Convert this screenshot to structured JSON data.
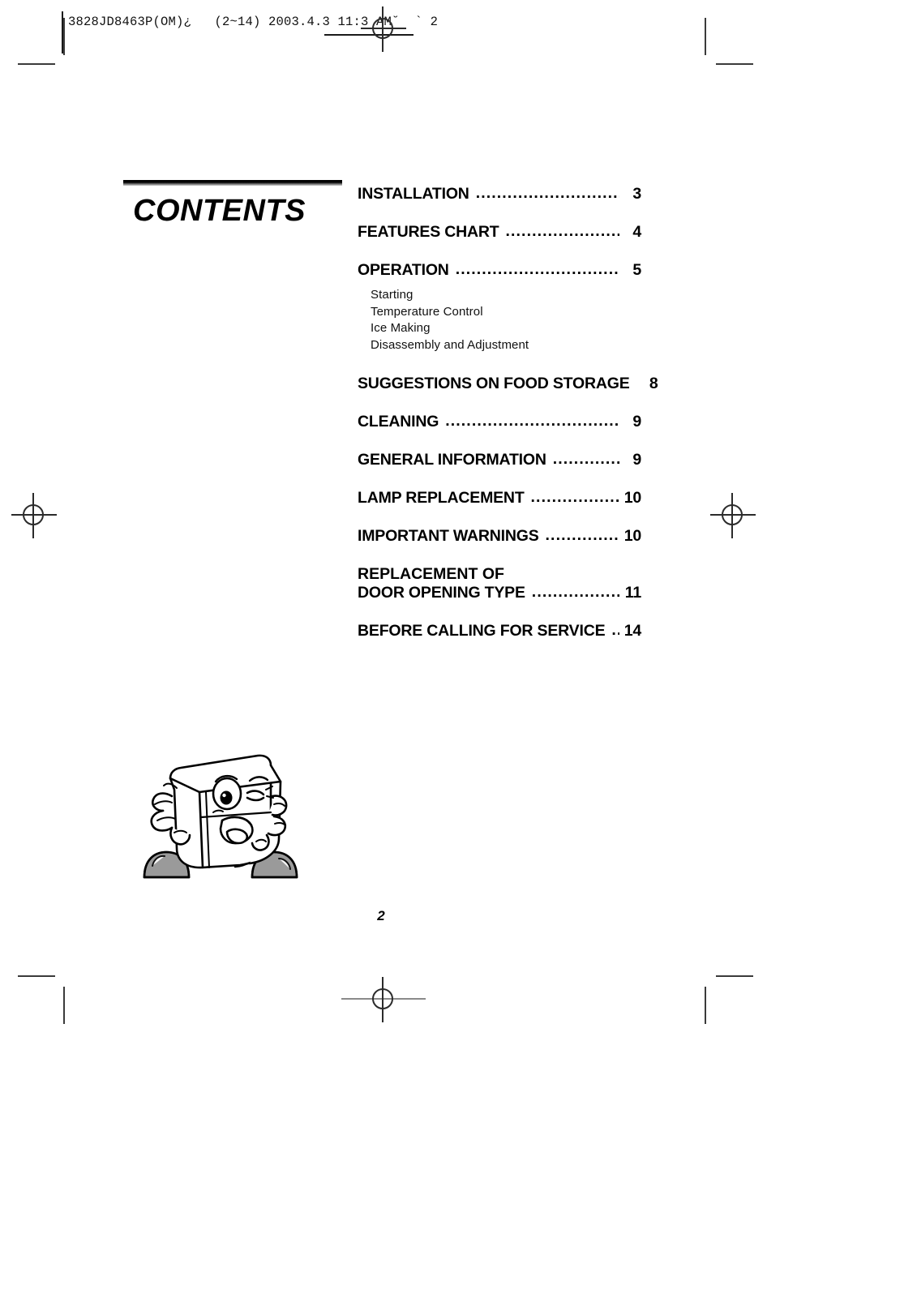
{
  "header": {
    "slug": "3828JD8463P(OM)¿   (2~14) 2003.4.3 11:3 AM˘  ` 2"
  },
  "contents": {
    "title": "CONTENTS"
  },
  "toc": {
    "entries": [
      {
        "label": "INSTALLATION",
        "dots": "..........................................",
        "page": "3"
      },
      {
        "label": "FEATURES CHART",
        "dots": "..................................",
        "page": "4"
      },
      {
        "label": "OPERATION",
        "dots": "..............................................",
        "page": "5"
      },
      {
        "label": "SUGGESTIONS ON FOOD STORAGE",
        "dots": "....",
        "page": "8"
      },
      {
        "label": "CLEANING",
        "dots": "...............................................",
        "page": "9"
      },
      {
        "label": "GENERAL INFORMATION",
        "dots": ".......................",
        "page": "9"
      },
      {
        "label": "LAMP REPLACEMENT",
        "dots": "............................",
        "page": "10"
      },
      {
        "label": "IMPORTANT WARNINGS",
        "dots": "..........................",
        "page": "10"
      },
      {
        "label": "REPLACEMENT OF",
        "label2": "DOOR OPENING TYPE",
        "dots": "............................",
        "page": "11"
      },
      {
        "label": "BEFORE CALLING FOR SERVICE",
        "dots": "..........",
        "page": "14"
      }
    ],
    "operation_subitems": [
      "Starting",
      "Temperature Control",
      "Ice Making",
      "Disassembly and Adjustment"
    ]
  },
  "mascot": {
    "description": "winking cartoon refrigerator character waving",
    "body_color": "#ffffff",
    "outline_color": "#000000",
    "shoe_color": "#9a9a9a"
  },
  "folio": {
    "page_number": "2"
  },
  "marks": {
    "crop_color": "#3b3b3b",
    "registration_color": "#2b2b2b"
  }
}
